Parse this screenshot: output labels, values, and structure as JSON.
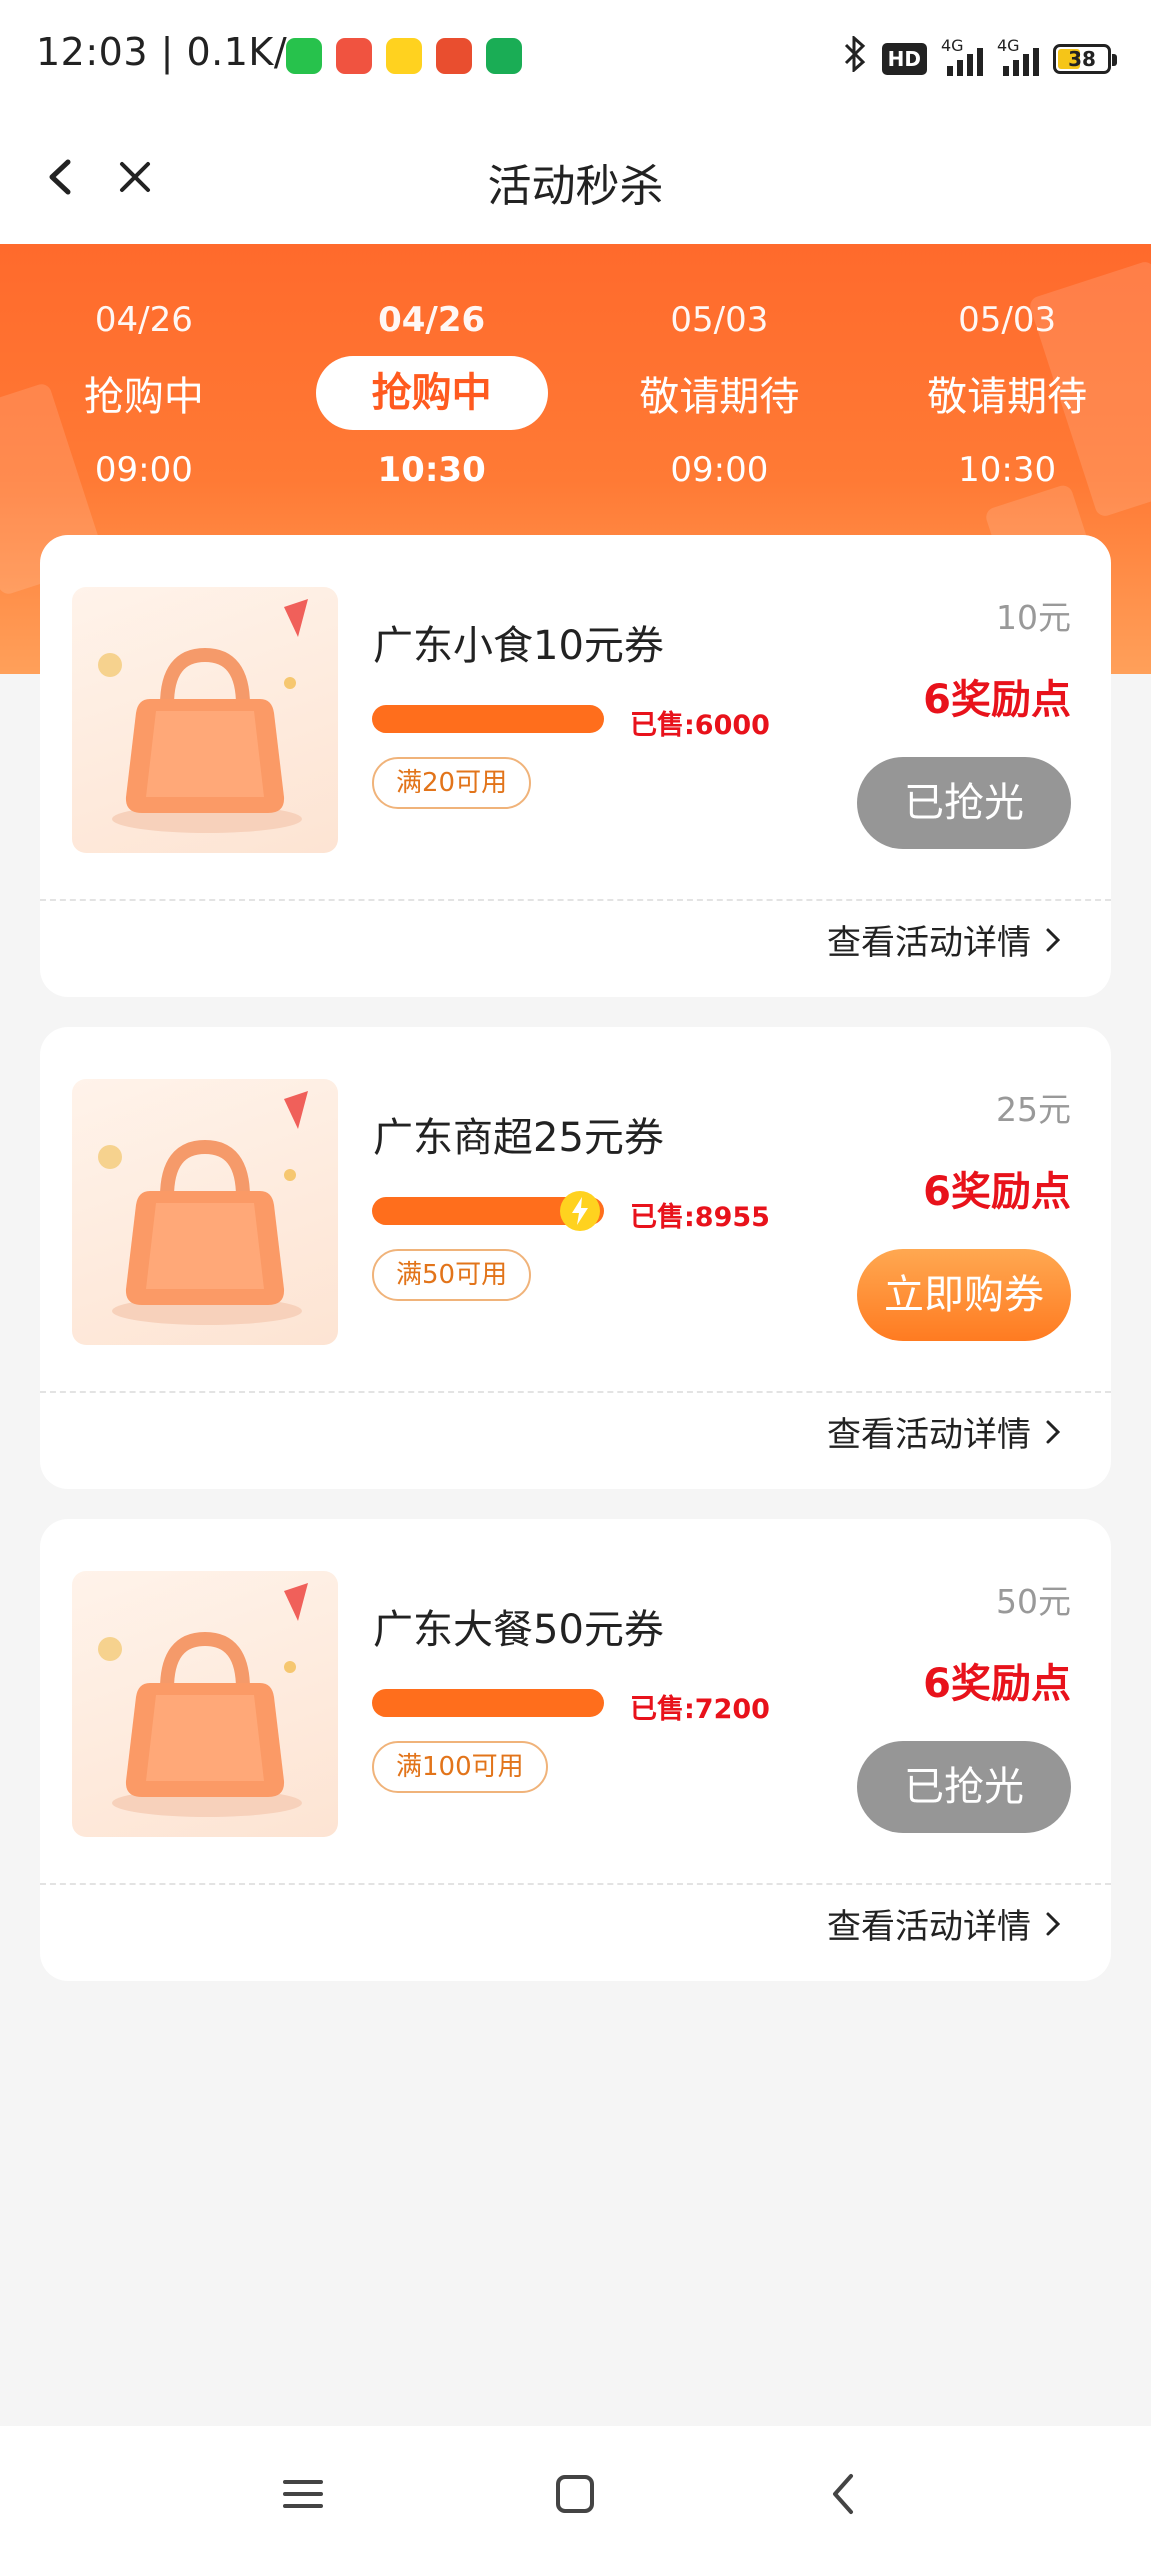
{
  "status_bar": {
    "time": "12:03 | 0.1K/s",
    "hd_label": "HD",
    "signal1_label": "4G",
    "signal2_label": "4G",
    "battery": "38",
    "app_icons": [
      "wechat-icon",
      "app-icon-red",
      "app-icon-yellow",
      "app-icon-orange",
      "phone-icon"
    ],
    "app_icon_colors": [
      "#27c24c",
      "#f05340",
      "#ffd21f",
      "#e94e2f",
      "#1aad55"
    ]
  },
  "navbar": {
    "title": "活动秒杀"
  },
  "theme": {
    "accent": "#ff6a2c",
    "price_red": "#e8121b",
    "sold_out_grey": "#969696"
  },
  "tabs": [
    {
      "date": "04/26",
      "status": "抢购中",
      "time": "09:00"
    },
    {
      "date": "04/26",
      "status": "抢购中",
      "time": "10:30"
    },
    {
      "date": "05/03",
      "status": "敬请期待",
      "time": "09:00"
    },
    {
      "date": "05/03",
      "status": "敬请期待",
      "time": "10:30"
    }
  ],
  "coupons": [
    {
      "title": "广东小食10元券",
      "sold": "已售:6000",
      "progress": 1.0,
      "condition": "满20可用",
      "value": "10元",
      "points": "6奖励点",
      "button": "已抢光",
      "button_state": "sold-out",
      "detail_link": "查看活动详情"
    },
    {
      "title": "广东商超25元券",
      "sold": "已售:8955",
      "progress": 1.0,
      "condition": "满50可用",
      "value": "25元",
      "points": "6奖励点",
      "button": "立即购券",
      "button_state": "available",
      "detail_link": "查看活动详情"
    },
    {
      "title": "广东大餐50元券",
      "sold": "已售:7200",
      "progress": 1.0,
      "condition": "满100可用",
      "value": "50元",
      "points": "6奖励点",
      "button": "已抢光",
      "button_state": "sold-out",
      "detail_link": "查看活动详情"
    }
  ],
  "system_nav": [
    "menu-icon",
    "home-icon",
    "back-icon"
  ]
}
